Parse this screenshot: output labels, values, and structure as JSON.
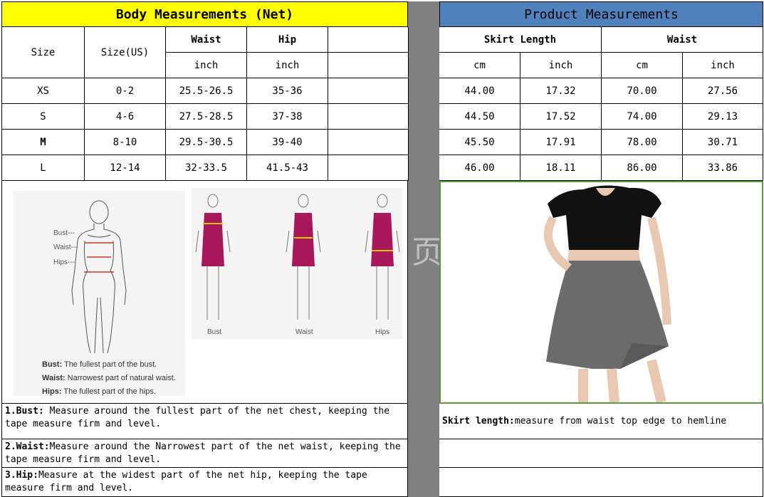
{
  "body_table": {
    "title": "Body Measurements (Net)",
    "headers": {
      "size": "Size",
      "size_us": "Size(US)",
      "waist": "Waist",
      "hip": "Hip",
      "waist_unit": "inch",
      "hip_unit": "inch"
    },
    "rows": [
      {
        "size": "XS",
        "us": "0-2",
        "waist": "25.5-26.5",
        "hip": "35-36"
      },
      {
        "size": "S",
        "us": "4-6",
        "waist": "27.5-28.5",
        "hip": "37-38"
      },
      {
        "size": "M",
        "us": "8-10",
        "waist": "29.5-30.5",
        "hip": "39-40"
      },
      {
        "size": "L",
        "us": "12-14",
        "waist": "32-33.5",
        "hip": "41.5-43"
      }
    ]
  },
  "product_table": {
    "title": "Product Measurements",
    "headers": {
      "skirt_length": "Skirt Length",
      "waist": "Waist",
      "cm": "cm",
      "inch": "inch"
    },
    "rows": [
      {
        "len_cm": "44.00",
        "len_in": "17.32",
        "waist_cm": "70.00",
        "waist_in": "27.56"
      },
      {
        "len_cm": "44.50",
        "len_in": "17.52",
        "waist_cm": "74.00",
        "waist_in": "29.13"
      },
      {
        "len_cm": "45.50",
        "len_in": "17.91",
        "waist_cm": "78.00",
        "waist_in": "30.71"
      },
      {
        "len_cm": "46.00",
        "len_in": "18.11",
        "waist_cm": "86.00",
        "waist_in": "33.86"
      }
    ]
  },
  "figure_labels": {
    "bust": "Bust---",
    "waist": "Waist---",
    "hips": "Hips---",
    "cap_bust": "Bust",
    "cap_waist": "Waist",
    "cap_hips": "Hips"
  },
  "definitions": [
    {
      "term": "Bust:",
      "text": "The fullest part of the bust."
    },
    {
      "term": "Waist:",
      "text": "Narrowest part of natural waist."
    },
    {
      "term": "Hips:",
      "text": "The fullest part of the hips."
    }
  ],
  "notes": [
    {
      "term": "1.Bust:",
      "text": " Measure around the fullest part of the net chest, keeping the tape  measure firm and level."
    },
    {
      "term": "2.Waist:",
      "text": "Measure around the Narrowest part of the net waist, keeping the tape  measure firm and level."
    },
    {
      "term": "3.Hip:",
      "text": "Measure at the widest part of the net hip, keeping the tape measure firm and level."
    }
  ],
  "skirt_note": {
    "term": "Skirt length:",
    "text": " measure from waist top edge to hemline"
  },
  "watermark": "页",
  "colors": {
    "left_header": "#ffff00",
    "right_header": "#4f81bd",
    "divider": "#808080",
    "photo_border": "#5a9a3a",
    "dress": "#a8175a",
    "top": "#111111",
    "skirt": "#6b6b6b"
  }
}
